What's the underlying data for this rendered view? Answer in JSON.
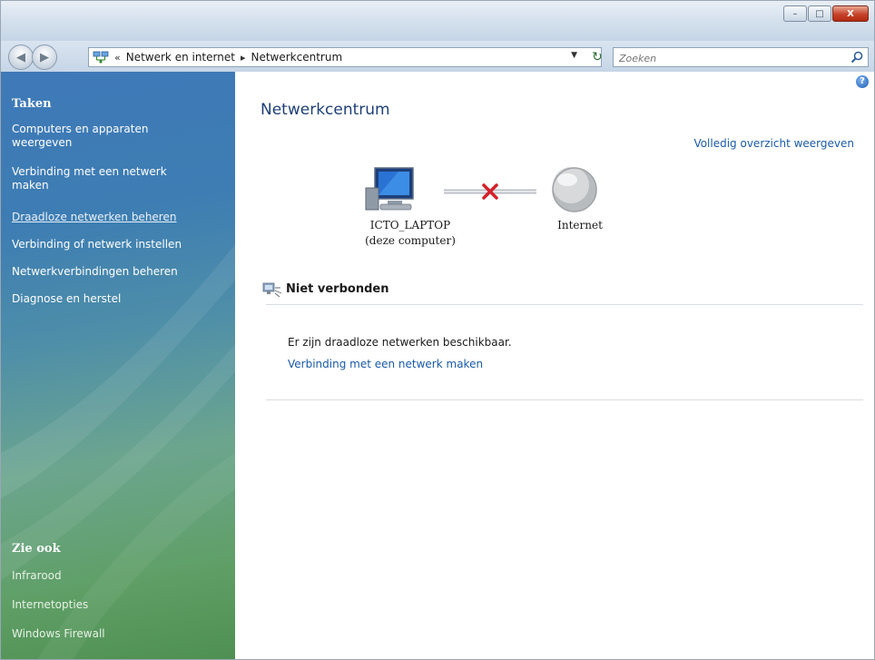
{
  "window": {
    "caption_buttons": {
      "minimize": "–",
      "maximize": "□",
      "close": "X"
    }
  },
  "navigation": {
    "back_icon": "back-arrow-icon",
    "forward_icon": "forward-arrow-icon",
    "address": {
      "overflow": "«",
      "crumbs": [
        "Netwerk en internet",
        "Netwerkcentrum"
      ],
      "separator": "▸"
    },
    "search": {
      "placeholder": "Zoeken"
    }
  },
  "sidebar": {
    "tasks_title": "Taken",
    "tasks": [
      "Computers en apparaten weergeven",
      "Verbinding met een netwerk maken",
      "Draadloze netwerken beheren",
      "Verbinding of netwerk instellen",
      "Netwerkverbindingen beheren",
      "Diagnose en herstel"
    ],
    "see_also_title": "Zie ook",
    "see_also": [
      "Infrarood",
      "Internetopties",
      "Windows Firewall"
    ]
  },
  "main": {
    "title": "Netwerkcentrum",
    "full_map_link": "Volledig overzicht weergeven",
    "computer_name": "ICTO_LAPTOP",
    "computer_sub": "(deze computer)",
    "internet_label": "Internet",
    "status_header": "Niet verbonden",
    "info_text": "Er zijn draadloze netwerken beschikbaar.",
    "connect_link": "Verbinding met een netwerk maken"
  },
  "colors": {
    "link": "#1a5aa8",
    "title": "#1e3f78",
    "disconnect_x": "#d4202a"
  }
}
